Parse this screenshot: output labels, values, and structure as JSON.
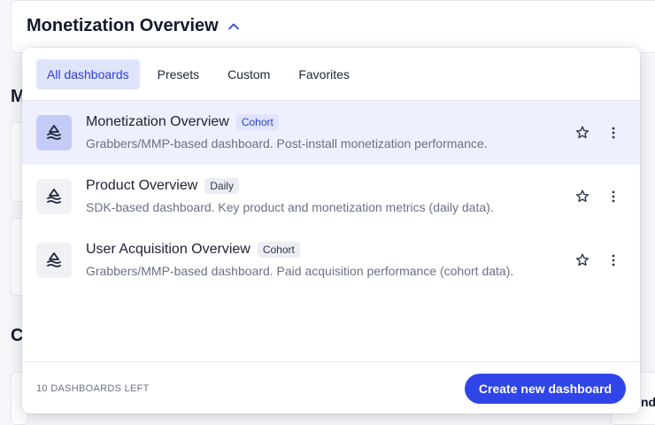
{
  "header": {
    "title": "Monetization Overview"
  },
  "background": {
    "letter_m": "M",
    "letter_c": "C",
    "right_fragment": "nd"
  },
  "tabs": [
    {
      "label": "All dashboards",
      "active": true
    },
    {
      "label": "Presets",
      "active": false
    },
    {
      "label": "Custom",
      "active": false
    },
    {
      "label": "Favorites",
      "active": false
    }
  ],
  "dashboards": [
    {
      "name": "Monetization Overview",
      "badge": "Cohort",
      "description": "Grabbers/MMP-based dashboard. Post-install monetization performance.",
      "selected": true,
      "icon": "dashboard-logo-icon"
    },
    {
      "name": "Product Overview",
      "badge": "Daily",
      "description": "SDK-based dashboard. Key product and monetization metrics (daily data).",
      "selected": false,
      "icon": "dashboard-logo-icon"
    },
    {
      "name": "User Acquisition Overview",
      "badge": "Cohort",
      "description": "Grabbers/MMP-based dashboard. Paid acquisition performance (cohort data).",
      "selected": false,
      "icon": "dashboard-logo-icon"
    }
  ],
  "footer": {
    "count_label": "10 DASHBOARDS LEFT",
    "create_label": "Create new dashboard"
  },
  "colors": {
    "accent": "#2f45e8",
    "selected_row": "#eef0fd",
    "active_tab": "#dfe4fb"
  }
}
